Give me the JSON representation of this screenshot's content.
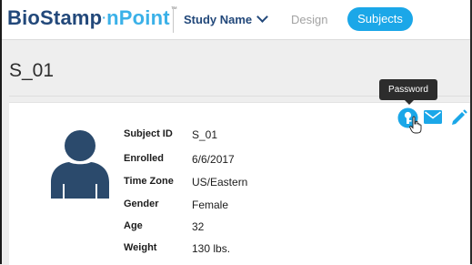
{
  "colors": {
    "brand_dark": "#22487a",
    "brand_light": "#3bb1e8",
    "accent": "#1ba7e8",
    "tooltip_bg": "#2c2c2c"
  },
  "header": {
    "logo_part1": "BioStamp",
    "logo_part2": "nPoint",
    "logo_tm": "™",
    "study_name": "Study Name",
    "tab_design": "Design",
    "tab_subjects": "Subjects"
  },
  "page": {
    "title": "S_01"
  },
  "actions": {
    "tooltip": "Password",
    "icons": [
      "key-circle-icon",
      "envelope-icon",
      "pencil-icon"
    ]
  },
  "subject": {
    "fields": [
      {
        "label": "Subject ID",
        "value": "S_01"
      },
      {
        "label": "Enrolled",
        "value": "6/6/2017"
      },
      {
        "label": "Time Zone",
        "value": "US/Eastern"
      },
      {
        "label": "Gender",
        "value": "Female"
      },
      {
        "label": "Age",
        "value": "32"
      },
      {
        "label": "Weight",
        "value": "130 lbs."
      }
    ]
  }
}
